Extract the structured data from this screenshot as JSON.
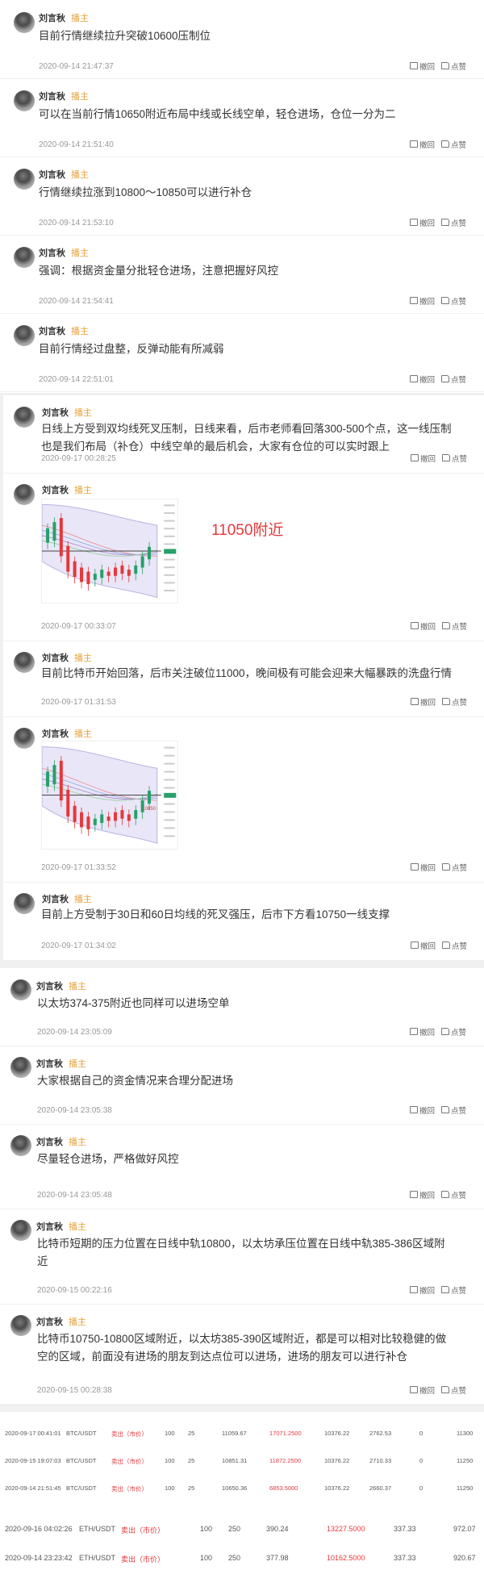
{
  "user": {
    "name": "刘言秋",
    "role": "播主"
  },
  "actions": {
    "withdraw": "撤回",
    "like": "点赞"
  },
  "colors": {
    "accent": "#e6a23c",
    "sell": "#e5383b"
  },
  "section1": [
    {
      "text": "目前行情继续拉升突破10600压制位",
      "time": "2020-09-14 21:47:37"
    },
    {
      "text": "可以在当前行情10650附近布局中线或长线空单，轻仓进场，仓位一分为二",
      "time": "2020-09-14 21:51:40"
    },
    {
      "text": "行情继续拉涨到10800～10850可以进行补仓",
      "time": "2020-09-14 21:53:10"
    },
    {
      "text": "强调：根据资金量分批轻仓进场，注意把握好风控",
      "time": "2020-09-14 21:54:41"
    },
    {
      "text": "目前行情经过盘整，反弹动能有所减弱",
      "time": "2020-09-14 22:51:01"
    }
  ],
  "section2": [
    {
      "text1": "日线上方受到双均线死叉压制，日线来看，后市老师看回落300-500个点，这一线压制",
      "text2": "也是我们布局（补仓）中线空单的最后机会，大家有仓位的可以实时跟上",
      "time": "2020-09-17 00:28:25"
    },
    {
      "annotation": "11050附近",
      "time": "2020-09-17 00:33:07"
    },
    {
      "text": "目前比特币开始回落，后市关注破位11000，晚间极有可能会迎来大幅暴跌的洗盘行情",
      "time": "2020-09-17 01:31:53"
    },
    {
      "time": "2020-09-17 01:33:52",
      "chart_label": "10850"
    },
    {
      "text": "目前上方受制于30日和60日均线的死叉强压，后市下方看10750一线支撑",
      "time": "2020-09-17 01:34:02"
    }
  ],
  "section3": [
    {
      "text": "以太坊374-375附近也同样可以进场空单",
      "time": "2020-09-14 23:05:09"
    },
    {
      "text": "大家根据自己的资金情况来合理分配进场",
      "time": "2020-09-14 23:05:38"
    },
    {
      "text": "尽量轻仓进场，严格做好风控",
      "time": "2020-09-14 23:05:48"
    },
    {
      "text1": "比特币短期的压力位置在日线中轨10800，以太坊承压位置在日线中轨385-386区域附",
      "text2": "近",
      "time": "2020-09-15 00:22:16"
    },
    {
      "text1": "比特币10750-10800区域附近，以太坊385-390区域附近，都是可以相对比较稳健的做",
      "text2": "空的区域，前面没有进场的朋友到达点位可以进场，进场的朋友可以进行补仓",
      "time": "2020-09-15 00:28:38"
    }
  ],
  "trades": [
    [
      "2020-09-17 00:41:01",
      "BTC/USDT",
      "卖出（市价）",
      "100",
      "25",
      "11059.67",
      "17071.2500",
      "10376.22",
      "2762.53",
      "0",
      "11300"
    ],
    [
      "2020-09-15 19:07:03",
      "BTC/USDT",
      "卖出（市价）",
      "100",
      "25",
      "10851.31",
      "11872.2500",
      "10376.22",
      "2710.33",
      "0",
      "11250"
    ],
    [
      "2020-09-14 21:51:45",
      "BTC/USDT",
      "卖出（市价）",
      "100",
      "25",
      "10650.36",
      "6853.5000",
      "10376.22",
      "2660.37",
      "0",
      "11250"
    ],
    [
      "2020-09-16 04:02:26",
      "ETH/USDT",
      "卖出（市价）",
      "100",
      "250",
      "390.24",
      "13227.5000",
      "337.33",
      "",
      "",
      "972.07"
    ],
    [
      "2020-09-14 23:23:42",
      "ETH/USDT",
      "卖出（市价）",
      "100",
      "250",
      "377.98",
      "10162.5000",
      "337.33",
      "",
      "",
      "920.67"
    ]
  ]
}
